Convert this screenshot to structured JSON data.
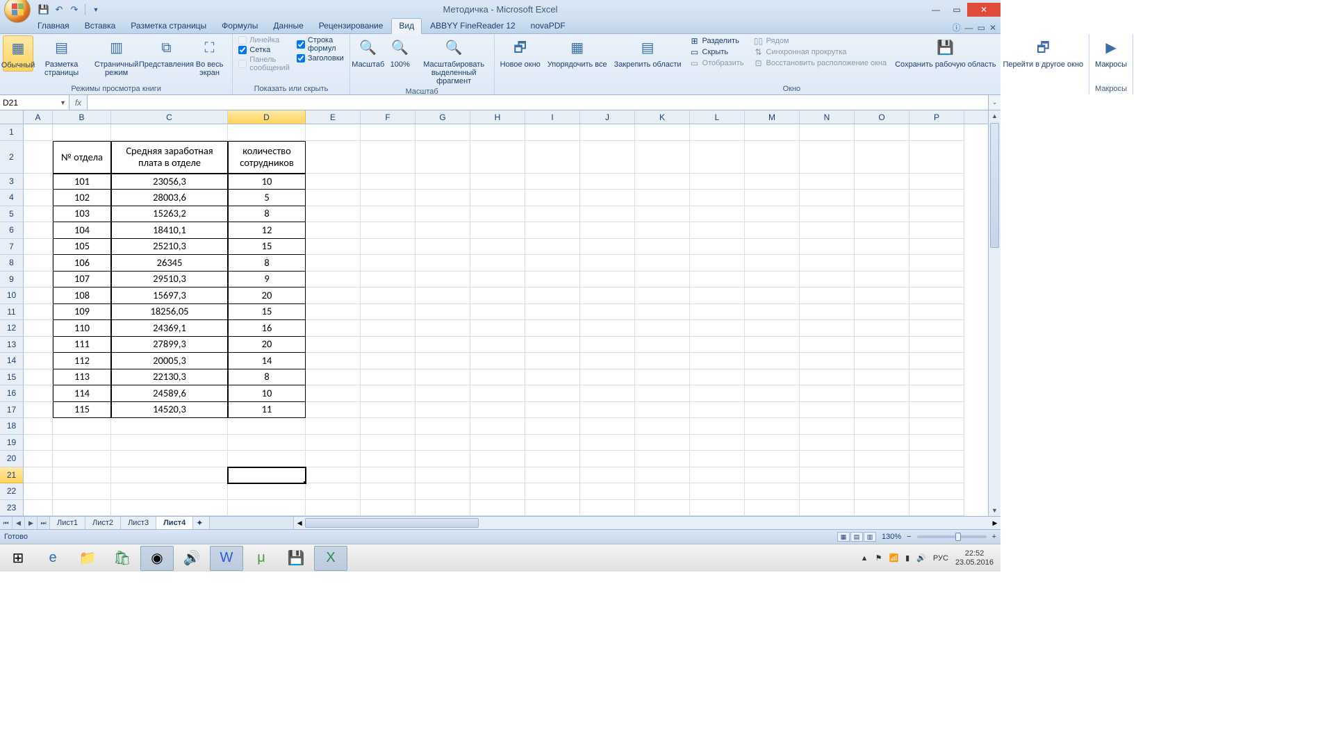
{
  "title": "Методичка - Microsoft Excel",
  "qat": {
    "save": "save-icon",
    "undo": "undo-icon",
    "redo": "redo-icon"
  },
  "tabs": [
    "Главная",
    "Вставка",
    "Разметка страницы",
    "Формулы",
    "Данные",
    "Рецензирование",
    "Вид",
    "ABBYY FineReader 12",
    "novaPDF"
  ],
  "active_tab": 6,
  "ribbon": {
    "group_views": {
      "label": "Режимы просмотра книги",
      "normal": "Обычный",
      "page_layout": "Разметка\nстраницы",
      "page_break": "Страничный\nрежим",
      "custom": "Представления",
      "full": "Во весь\nэкран"
    },
    "group_show": {
      "label": "Показать или скрыть",
      "ruler": "Линейка",
      "formula_bar": "Строка формул",
      "gridlines": "Сетка",
      "headings": "Заголовки",
      "message_bar": "Панель сообщений"
    },
    "group_zoom": {
      "label": "Масштаб",
      "zoom": "Масштаб",
      "hundred": "100%",
      "selection": "Масштабировать\nвыделенный фрагмент"
    },
    "group_window": {
      "label": "Окно",
      "new": "Новое\nокно",
      "arrange": "Упорядочить\nвсе",
      "freeze": "Закрепить\nобласти",
      "split": "Разделить",
      "hide": "Скрыть",
      "unhide": "Отобразить",
      "side": "Рядом",
      "sync": "Синхронная прокрутка",
      "reset": "Восстановить расположение окна",
      "save_ws": "Сохранить\nрабочую область",
      "switch": "Перейти в\nдругое окно"
    },
    "group_macros": {
      "label": "Макросы",
      "macros": "Макросы"
    }
  },
  "namebox": "D21",
  "columns": [
    "A",
    "B",
    "C",
    "D",
    "E",
    "F",
    "G",
    "H",
    "I",
    "J",
    "K",
    "L",
    "M",
    "N",
    "O",
    "P"
  ],
  "rows_visible": 23,
  "selected_cell": {
    "row": 21,
    "col": "D"
  },
  "headers": {
    "B": "№ отдела",
    "C": "Средняя заработная плата в отделе",
    "D": "количество сотрудников"
  },
  "data_rows": [
    {
      "B": "101",
      "C": "23056,3",
      "D": "10"
    },
    {
      "B": "102",
      "C": "28003,6",
      "D": "5"
    },
    {
      "B": "103",
      "C": "15263,2",
      "D": "8"
    },
    {
      "B": "104",
      "C": "18410,1",
      "D": "12"
    },
    {
      "B": "105",
      "C": "25210,3",
      "D": "15"
    },
    {
      "B": "106",
      "C": "26345",
      "D": "8"
    },
    {
      "B": "107",
      "C": "29510,3",
      "D": "9"
    },
    {
      "B": "108",
      "C": "15697,3",
      "D": "20"
    },
    {
      "B": "109",
      "C": "18256,05",
      "D": "15"
    },
    {
      "B": "110",
      "C": "24369,1",
      "D": "16"
    },
    {
      "B": "111",
      "C": "27899,3",
      "D": "20"
    },
    {
      "B": "112",
      "C": "20005,3",
      "D": "14"
    },
    {
      "B": "113",
      "C": "22130,3",
      "D": "8"
    },
    {
      "B": "114",
      "C": "24589,6",
      "D": "10"
    },
    {
      "B": "115",
      "C": "14520,3",
      "D": "11"
    }
  ],
  "sheets": [
    "Лист1",
    "Лист2",
    "Лист3",
    "Лист4"
  ],
  "active_sheet": 3,
  "status_text": "Готово",
  "zoom": "130%",
  "tray": {
    "lang": "РУС",
    "time": "22:52",
    "date": "23.05.2016"
  }
}
